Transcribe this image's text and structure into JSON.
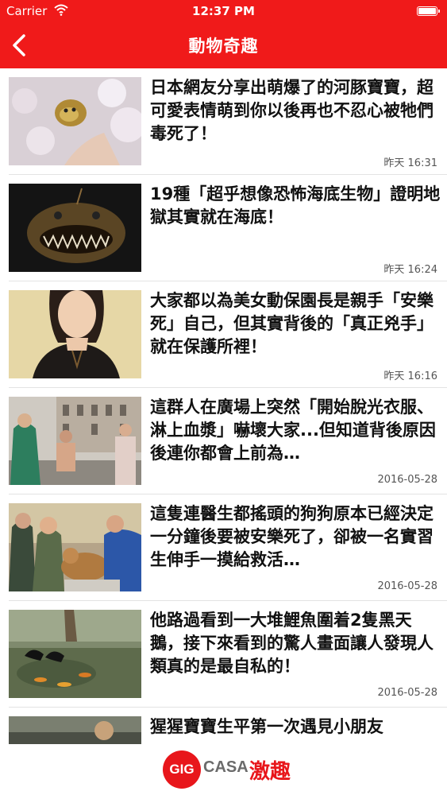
{
  "statusbar": {
    "carrier": "Carrier",
    "time": "12:37 PM"
  },
  "nav": {
    "title": "動物奇趣"
  },
  "articles": [
    {
      "headline": "日本網友分享出萌爆了的河豚寶寶，超可愛表情萌到你以後再也不忍心被牠們毒死了！",
      "time": "昨天 16:31",
      "thumb": "pufferfish-photo"
    },
    {
      "headline": "19種「超乎想像恐怖海底生物」證明地獄其實就在海底！",
      "time": "昨天 16:24",
      "thumb": "anglerfish-photo"
    },
    {
      "headline": "大家都以為美女動保園長是親手「安樂死」自己，但其實背後的「真正兇手」就在保護所裡！",
      "time": "昨天 16:16",
      "thumb": "woman-portrait-photo"
    },
    {
      "headline": "這群人在廣場上突然「開始脫光衣服、淋上血漿」嚇壞大家...但知道背後原因後連你都會上前為…",
      "time": "2016-05-28",
      "thumb": "square-protest-photo"
    },
    {
      "headline": "這隻連醫生都搖頭的狗狗原本已經決定一分鐘後要被安樂死了，卻被一名實習生伸手一摸給救活…",
      "time": "2016-05-28",
      "thumb": "vet-dog-photo"
    },
    {
      "headline": "他路過看到一大堆鯉魚圍着2隻黑天鵝，接下來看到的驚人畫面讓人發現人類真的是最自私的！",
      "time": "2016-05-28",
      "thumb": "swans-koi-photo"
    },
    {
      "headline": "猩猩寶寶生平第一次遇見小朋友",
      "time": "",
      "thumb": "gorilla-photo"
    }
  ],
  "brand": {
    "circle": "GIG",
    "casa": "CASA",
    "cn": "激趣",
    "accent": "#e8161b"
  },
  "colors": {
    "navbar": "#f01a1a"
  }
}
